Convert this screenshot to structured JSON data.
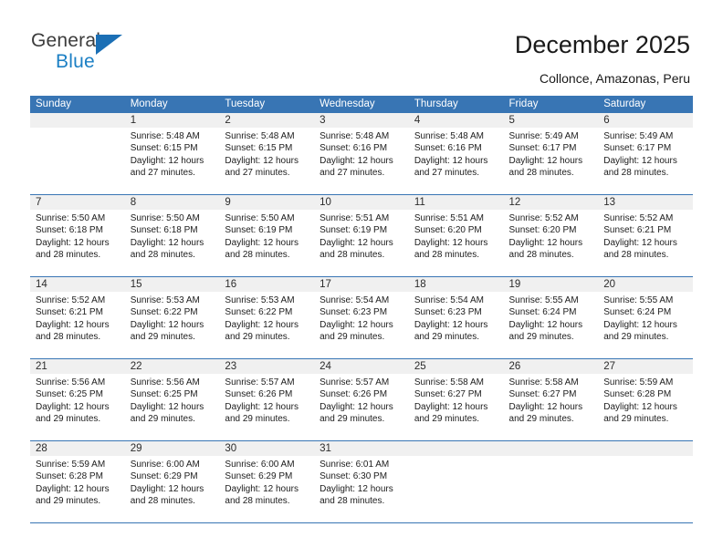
{
  "brand": {
    "name_part1": "General",
    "name_part2": "Blue",
    "triangle_icon": "triangle-icon",
    "color_dark": "#3c3c3c",
    "color_blue": "#1b7fc4"
  },
  "header": {
    "title": "December 2025",
    "subtitle": "Collonce, Amazonas, Peru"
  },
  "theme": {
    "header_blue": "#3875b4",
    "daynum_band": "#f0f0f0",
    "text": "#1c1c1c"
  },
  "calendar": {
    "weekdays": [
      "Sunday",
      "Monday",
      "Tuesday",
      "Wednesday",
      "Thursday",
      "Friday",
      "Saturday"
    ],
    "weeks": [
      [
        {
          "day": "",
          "sunrise": "",
          "sunset": "",
          "daylight": "",
          "empty": true
        },
        {
          "day": "1",
          "sunrise": "Sunrise: 5:48 AM",
          "sunset": "Sunset: 6:15 PM",
          "daylight": "Daylight: 12 hours and 27 minutes."
        },
        {
          "day": "2",
          "sunrise": "Sunrise: 5:48 AM",
          "sunset": "Sunset: 6:15 PM",
          "daylight": "Daylight: 12 hours and 27 minutes."
        },
        {
          "day": "3",
          "sunrise": "Sunrise: 5:48 AM",
          "sunset": "Sunset: 6:16 PM",
          "daylight": "Daylight: 12 hours and 27 minutes."
        },
        {
          "day": "4",
          "sunrise": "Sunrise: 5:48 AM",
          "sunset": "Sunset: 6:16 PM",
          "daylight": "Daylight: 12 hours and 27 minutes."
        },
        {
          "day": "5",
          "sunrise": "Sunrise: 5:49 AM",
          "sunset": "Sunset: 6:17 PM",
          "daylight": "Daylight: 12 hours and 28 minutes."
        },
        {
          "day": "6",
          "sunrise": "Sunrise: 5:49 AM",
          "sunset": "Sunset: 6:17 PM",
          "daylight": "Daylight: 12 hours and 28 minutes."
        }
      ],
      [
        {
          "day": "7",
          "sunrise": "Sunrise: 5:50 AM",
          "sunset": "Sunset: 6:18 PM",
          "daylight": "Daylight: 12 hours and 28 minutes."
        },
        {
          "day": "8",
          "sunrise": "Sunrise: 5:50 AM",
          "sunset": "Sunset: 6:18 PM",
          "daylight": "Daylight: 12 hours and 28 minutes."
        },
        {
          "day": "9",
          "sunrise": "Sunrise: 5:50 AM",
          "sunset": "Sunset: 6:19 PM",
          "daylight": "Daylight: 12 hours and 28 minutes."
        },
        {
          "day": "10",
          "sunrise": "Sunrise: 5:51 AM",
          "sunset": "Sunset: 6:19 PM",
          "daylight": "Daylight: 12 hours and 28 minutes."
        },
        {
          "day": "11",
          "sunrise": "Sunrise: 5:51 AM",
          "sunset": "Sunset: 6:20 PM",
          "daylight": "Daylight: 12 hours and 28 minutes."
        },
        {
          "day": "12",
          "sunrise": "Sunrise: 5:52 AM",
          "sunset": "Sunset: 6:20 PM",
          "daylight": "Daylight: 12 hours and 28 minutes."
        },
        {
          "day": "13",
          "sunrise": "Sunrise: 5:52 AM",
          "sunset": "Sunset: 6:21 PM",
          "daylight": "Daylight: 12 hours and 28 minutes."
        }
      ],
      [
        {
          "day": "14",
          "sunrise": "Sunrise: 5:52 AM",
          "sunset": "Sunset: 6:21 PM",
          "daylight": "Daylight: 12 hours and 28 minutes."
        },
        {
          "day": "15",
          "sunrise": "Sunrise: 5:53 AM",
          "sunset": "Sunset: 6:22 PM",
          "daylight": "Daylight: 12 hours and 29 minutes."
        },
        {
          "day": "16",
          "sunrise": "Sunrise: 5:53 AM",
          "sunset": "Sunset: 6:22 PM",
          "daylight": "Daylight: 12 hours and 29 minutes."
        },
        {
          "day": "17",
          "sunrise": "Sunrise: 5:54 AM",
          "sunset": "Sunset: 6:23 PM",
          "daylight": "Daylight: 12 hours and 29 minutes."
        },
        {
          "day": "18",
          "sunrise": "Sunrise: 5:54 AM",
          "sunset": "Sunset: 6:23 PM",
          "daylight": "Daylight: 12 hours and 29 minutes."
        },
        {
          "day": "19",
          "sunrise": "Sunrise: 5:55 AM",
          "sunset": "Sunset: 6:24 PM",
          "daylight": "Daylight: 12 hours and 29 minutes."
        },
        {
          "day": "20",
          "sunrise": "Sunrise: 5:55 AM",
          "sunset": "Sunset: 6:24 PM",
          "daylight": "Daylight: 12 hours and 29 minutes."
        }
      ],
      [
        {
          "day": "21",
          "sunrise": "Sunrise: 5:56 AM",
          "sunset": "Sunset: 6:25 PM",
          "daylight": "Daylight: 12 hours and 29 minutes."
        },
        {
          "day": "22",
          "sunrise": "Sunrise: 5:56 AM",
          "sunset": "Sunset: 6:25 PM",
          "daylight": "Daylight: 12 hours and 29 minutes."
        },
        {
          "day": "23",
          "sunrise": "Sunrise: 5:57 AM",
          "sunset": "Sunset: 6:26 PM",
          "daylight": "Daylight: 12 hours and 29 minutes."
        },
        {
          "day": "24",
          "sunrise": "Sunrise: 5:57 AM",
          "sunset": "Sunset: 6:26 PM",
          "daylight": "Daylight: 12 hours and 29 minutes."
        },
        {
          "day": "25",
          "sunrise": "Sunrise: 5:58 AM",
          "sunset": "Sunset: 6:27 PM",
          "daylight": "Daylight: 12 hours and 29 minutes."
        },
        {
          "day": "26",
          "sunrise": "Sunrise: 5:58 AM",
          "sunset": "Sunset: 6:27 PM",
          "daylight": "Daylight: 12 hours and 29 minutes."
        },
        {
          "day": "27",
          "sunrise": "Sunrise: 5:59 AM",
          "sunset": "Sunset: 6:28 PM",
          "daylight": "Daylight: 12 hours and 29 minutes."
        }
      ],
      [
        {
          "day": "28",
          "sunrise": "Sunrise: 5:59 AM",
          "sunset": "Sunset: 6:28 PM",
          "daylight": "Daylight: 12 hours and 29 minutes."
        },
        {
          "day": "29",
          "sunrise": "Sunrise: 6:00 AM",
          "sunset": "Sunset: 6:29 PM",
          "daylight": "Daylight: 12 hours and 28 minutes."
        },
        {
          "day": "30",
          "sunrise": "Sunrise: 6:00 AM",
          "sunset": "Sunset: 6:29 PM",
          "daylight": "Daylight: 12 hours and 28 minutes."
        },
        {
          "day": "31",
          "sunrise": "Sunrise: 6:01 AM",
          "sunset": "Sunset: 6:30 PM",
          "daylight": "Daylight: 12 hours and 28 minutes."
        },
        {
          "day": "",
          "sunrise": "",
          "sunset": "",
          "daylight": "",
          "empty": true
        },
        {
          "day": "",
          "sunrise": "",
          "sunset": "",
          "daylight": "",
          "empty": true
        },
        {
          "day": "",
          "sunrise": "",
          "sunset": "",
          "daylight": "",
          "empty": true
        }
      ]
    ]
  }
}
